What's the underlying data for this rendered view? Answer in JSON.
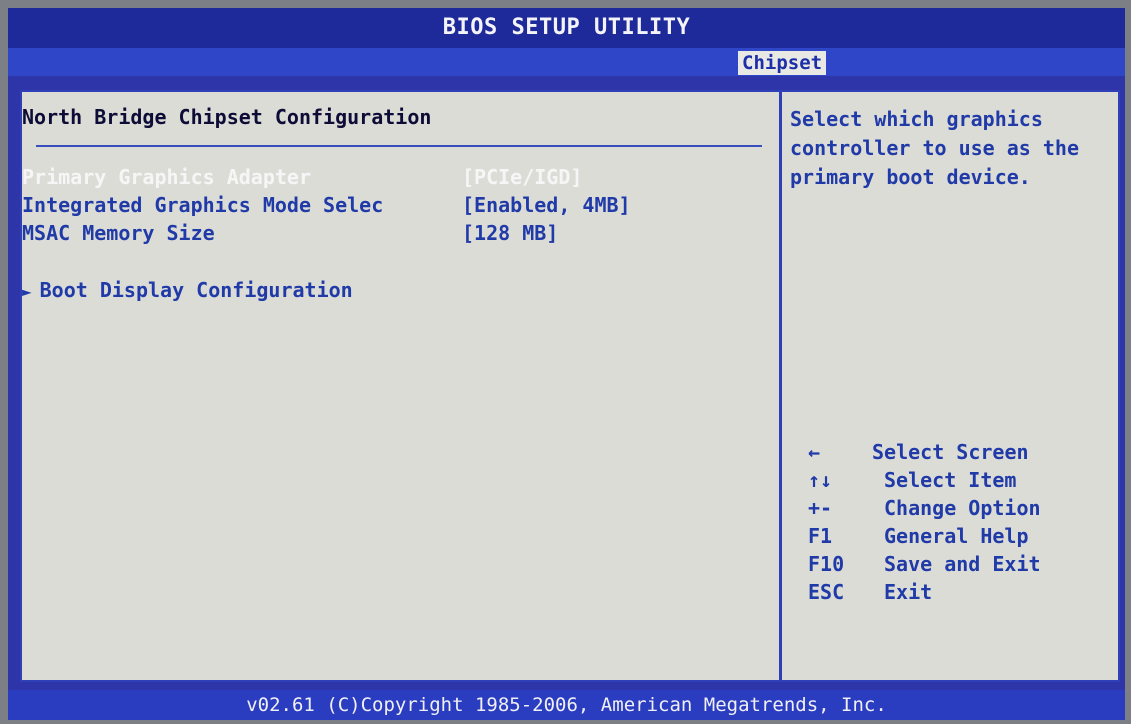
{
  "header": {
    "title": "BIOS SETUP UTILITY",
    "active_tab": "Chipset"
  },
  "section": {
    "title": "North Bridge Chipset Configuration"
  },
  "items": [
    {
      "label": "Primary Graphics Adapter",
      "value": "[PCIe/IGD]"
    },
    {
      "label": "Integrated Graphics Mode Selec",
      "value": "[Enabled, 4MB]"
    },
    {
      "label": "MSAC Memory Size",
      "value": "[128 MB]"
    }
  ],
  "submenu": {
    "arrow": "►",
    "label": "Boot Display Configuration"
  },
  "help": {
    "text": "Select which graphics controller to use as the primary boot device."
  },
  "keys": [
    {
      "key": "←",
      "desc": "Select Screen"
    },
    {
      "key": "↑↓",
      "desc": "Select Item"
    },
    {
      "key": "+-",
      "desc": "Change Option"
    },
    {
      "key": "F1",
      "desc": "General Help"
    },
    {
      "key": "F10",
      "desc": "Save and Exit"
    },
    {
      "key": "ESC",
      "desc": "Exit"
    }
  ],
  "footer": {
    "text": "v02.61 (C)Copyright 1985-2006, American Megatrends, Inc."
  },
  "colors": {
    "background": "#2e35a8",
    "panel": "#dcdcd7",
    "text": "#203aa8",
    "selected_text": "#f6f6f6"
  }
}
